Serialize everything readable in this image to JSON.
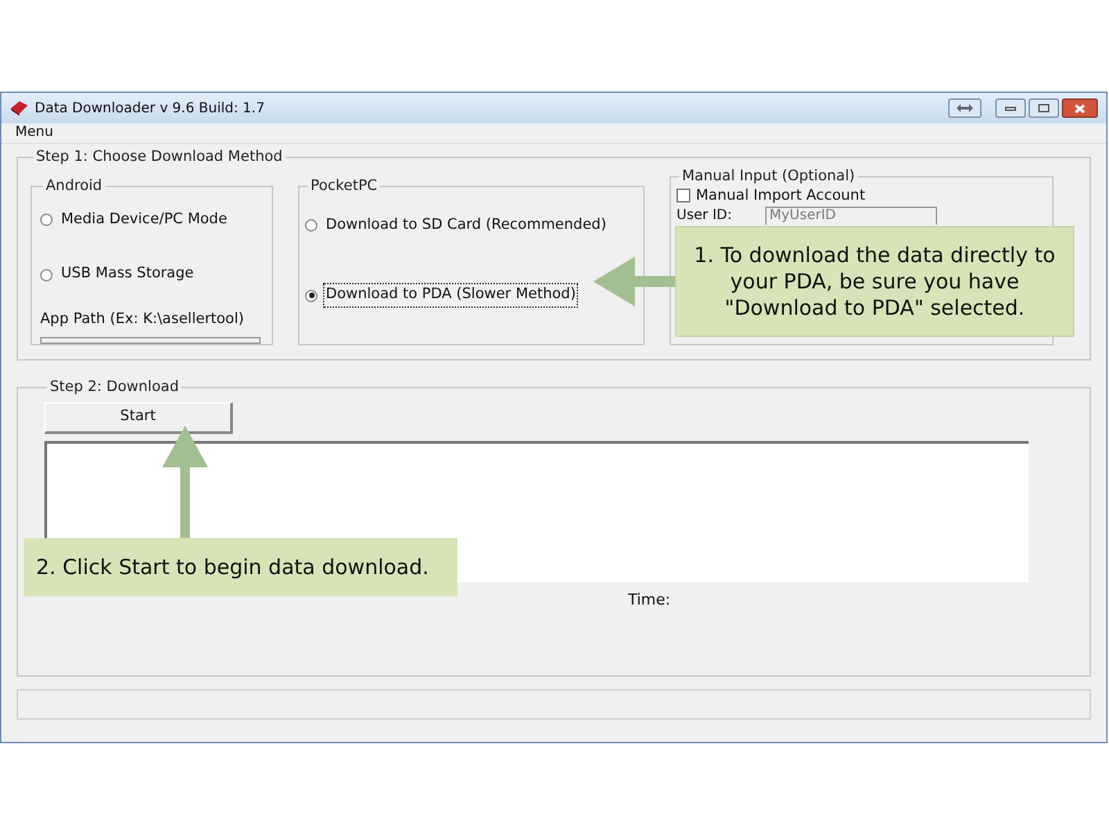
{
  "window": {
    "title": "Data Downloader v 9.6 Build: 1.7"
  },
  "menu": [
    "Menu"
  ],
  "step1": {
    "title": "Step 1: Choose Download Method",
    "android": {
      "title": "Android",
      "options": [
        {
          "label": "Media Device/PC Mode",
          "selected": false
        },
        {
          "label": "USB Mass Storage",
          "selected": false
        }
      ],
      "app_path_label": "App Path (Ex: K:\\asellertool)"
    },
    "pocketpc": {
      "title": "PocketPC",
      "options": [
        {
          "label": "Download to SD Card (Recommended)",
          "selected": false
        },
        {
          "label": "Download to PDA (Slower Method)",
          "selected": true
        }
      ]
    },
    "manual": {
      "title": "Manual Input (Optional)",
      "checkbox": {
        "label": "Manual Import Account",
        "checked": false
      },
      "user_id_label": "User ID:",
      "user_id_placeholder": "MyUserID"
    }
  },
  "step2": {
    "title": "Step 2: Download",
    "start_button": "Start",
    "time_label": "Time:"
  },
  "callouts": [
    {
      "text": "1. To download the data directly to your PDA, be sure you have \"Download to PDA\" selected."
    },
    {
      "text": "2. Click Start to begin data download."
    }
  ]
}
